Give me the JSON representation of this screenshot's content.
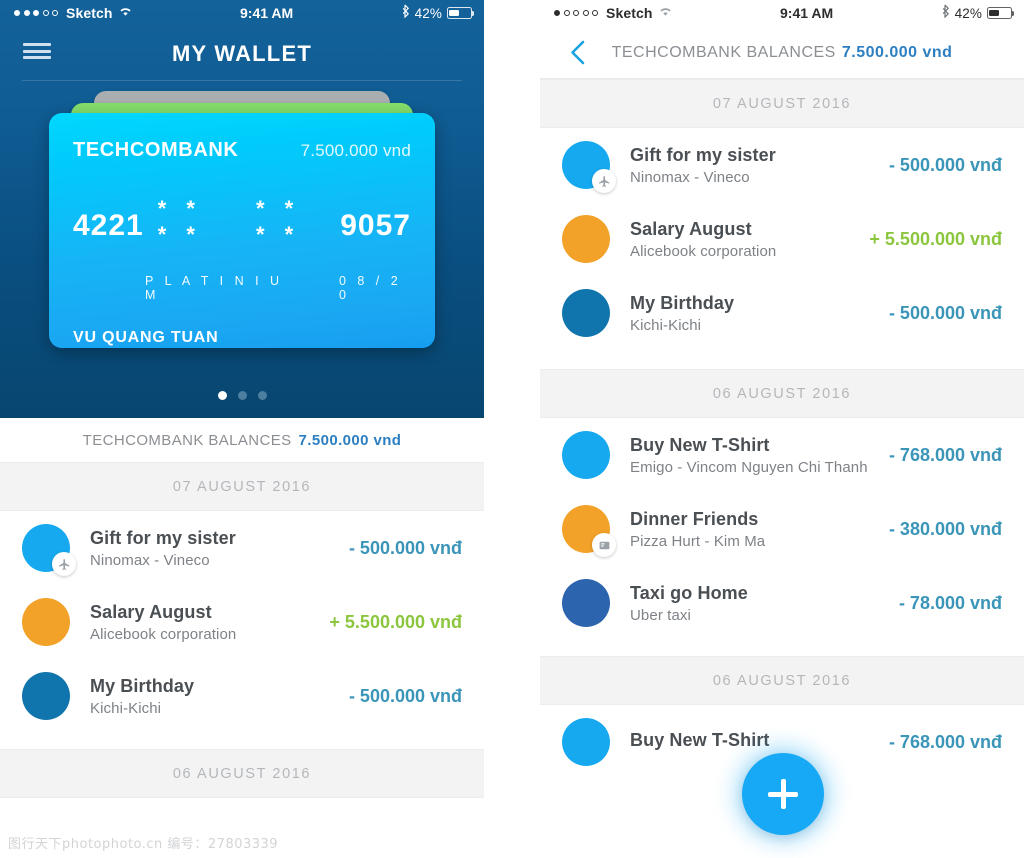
{
  "left": {
    "status_bar": {
      "signal_dots_total": 5,
      "signal_dots_filled": 3,
      "carrier": "Sketch",
      "wifi_icon": "wifi-icon",
      "time": "9:41 AM",
      "bluetooth_icon": "bluetooth-icon",
      "battery_percent": "42%",
      "battery_icon": "battery-icon"
    },
    "nav": {
      "menu_icon": "hamburger-menu-icon",
      "title": "MY WALLET"
    },
    "card": {
      "bank_name": "TECHCOMBANK",
      "balance": "7.500.000 vnd",
      "number_first": "4221",
      "number_mask_1": "* * * *",
      "number_mask_2": "* * * *",
      "number_last": "9057",
      "tier": "P L A T I N I U M",
      "expiry": "0 8 / 2 0",
      "holder": "VU QUANG TUAN",
      "front_color": "#00d8ff",
      "mid_color": "#84dd6b",
      "back_color": "#a9aeb1"
    },
    "pager": {
      "total": 3,
      "active_index": 0
    },
    "balance_bar": {
      "label": "TECHCOMBANK BALANCES",
      "value": "7.500.000 vnd"
    },
    "sections": [
      {
        "date": "07 AUGUST 2016",
        "transactions": [
          {
            "title": "Gift for my sister",
            "subtitle": "Ninomax - Vineco",
            "amount": "- 500.000 vnđ",
            "sign": "neg",
            "avatar_color": "#16a9ef",
            "badge_icon": "airplane-icon"
          },
          {
            "title": "Salary August",
            "subtitle": "Alicebook corporation",
            "amount": "+ 5.500.000 vnđ",
            "sign": "pos",
            "avatar_color": "#f2a229",
            "badge_icon": null
          },
          {
            "title": "My Birthday",
            "subtitle": "Kichi-Kichi",
            "amount": "- 500.000 vnđ",
            "sign": "neg",
            "avatar_color": "#1175ad",
            "badge_icon": null
          }
        ]
      },
      {
        "date": "06 AUGUST 2016",
        "transactions": []
      }
    ]
  },
  "right": {
    "status_bar": {
      "signal_dots_total": 5,
      "signal_dots_filled": 1,
      "carrier": "Sketch",
      "wifi_icon": "wifi-icon",
      "time": "9:41 AM",
      "bluetooth_icon": "bluetooth-icon",
      "battery_percent": "42%",
      "battery_icon": "battery-icon"
    },
    "nav": {
      "back_icon": "chevron-left-icon",
      "label": "TECHCOMBANK BALANCES",
      "value": "7.500.000 vnd"
    },
    "sections": [
      {
        "date": "07 AUGUST 2016",
        "transactions": [
          {
            "title": "Gift for my sister",
            "subtitle": "Ninomax - Vineco",
            "amount": "- 500.000 vnđ",
            "sign": "neg",
            "avatar_color": "#16a9ef",
            "badge_icon": "airplane-icon"
          },
          {
            "title": "Salary August",
            "subtitle": "Alicebook corporation",
            "amount": "+ 5.500.000 vnđ",
            "sign": "pos",
            "avatar_color": "#f2a229",
            "badge_icon": null
          },
          {
            "title": "My Birthday",
            "subtitle": "Kichi-Kichi",
            "amount": "- 500.000 vnđ",
            "sign": "neg",
            "avatar_color": "#1175ad",
            "badge_icon": null
          }
        ]
      },
      {
        "date": "06 AUGUST 2016",
        "transactions": [
          {
            "title": "Buy New T-Shirt",
            "subtitle": "Emigo - Vincom Nguyen Chi Thanh",
            "amount": "- 768.000 vnđ",
            "sign": "neg",
            "avatar_color": "#16a9ef",
            "badge_icon": null
          },
          {
            "title": "Dinner Friends",
            "subtitle": "Pizza Hurt - Kim Ma",
            "amount": "- 380.000 vnđ",
            "sign": "neg",
            "avatar_color": "#f2a229",
            "badge_icon": "receipt-icon"
          },
          {
            "title": "Taxi go Home",
            "subtitle": "Uber taxi",
            "amount": "- 78.000 vnđ",
            "sign": "neg",
            "avatar_color": "#2d64ae",
            "badge_icon": null
          }
        ]
      },
      {
        "date": "06 AUGUST 2016",
        "transactions": [
          {
            "title": "Buy New T-Shirt",
            "subtitle": "",
            "amount": "- 768.000 vnđ",
            "sign": "neg",
            "avatar_color": "#16a9ef",
            "badge_icon": null
          }
        ]
      }
    ],
    "fab": {
      "icon": "plus-icon"
    }
  },
  "watermark": "图行天下photophoto.cn  编号：27803339",
  "colors": {
    "hero_top": "#14629a",
    "hero_bottom": "#07466f",
    "accent_blue": "#2d7fc1",
    "amount_negative": "#3b95b8",
    "amount_positive": "#8cc63e",
    "fab": "#17a9f5",
    "date_band": "#f3f3f4"
  }
}
